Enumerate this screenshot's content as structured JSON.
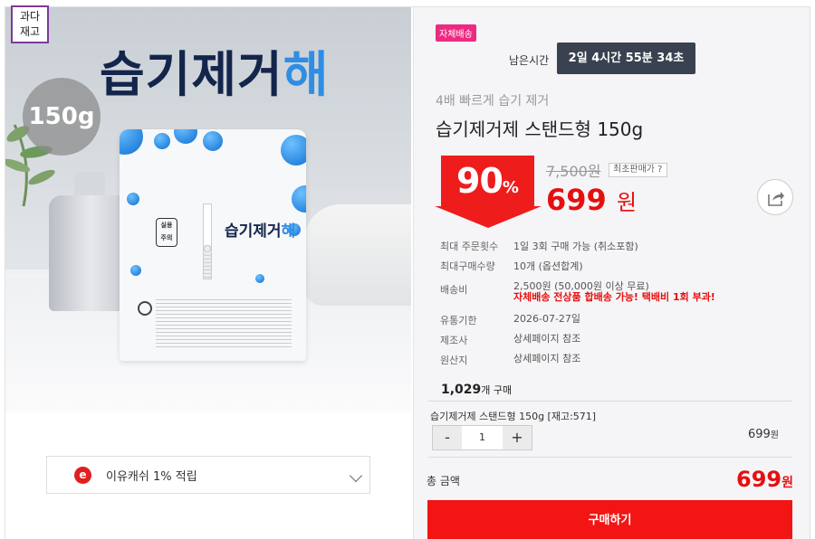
{
  "image": {
    "brand_title_main": "습기제거",
    "brand_title_accent": "해",
    "weight_badge": "150g",
    "overstock_badge_line1": "과다",
    "overstock_badge_line2": "재고",
    "pouch_logo_main": "습기제거",
    "pouch_logo_accent": "해",
    "pouch_caution_line1": "실용",
    "pouch_caution_line2": "주의"
  },
  "points": {
    "icon_letter": "e",
    "label": "이유캐쉬 1% 적립"
  },
  "header": {
    "delivery_badge": "자체배송",
    "remain_label": "남은시간",
    "timer": "2일 4시간 55분 34초"
  },
  "product": {
    "subtitle": "4배 빠르게 습기 제거",
    "title": "습기제거제 스탠드형 150g",
    "discount_number": "90",
    "discount_suffix": "%",
    "original_price": "7,500원",
    "lowest_price_button": "최초판매가 ?",
    "sale_price": "699",
    "sale_unit": "원"
  },
  "info": [
    {
      "label": "최대 주문횟수",
      "value": "1일 3회 구매 가능 (취소포함)"
    },
    {
      "label": "최대구매수량",
      "value": "10개 (옵션합계)"
    },
    {
      "label": "배송비",
      "value": "2,500원 (50,000원 이상 무료)",
      "warn": "자체배송 전상품 합배송 가능! 택배비 1회 부과!"
    },
    {
      "label": "유통기한",
      "value": "2026-07-27일"
    },
    {
      "label": "제조사",
      "value": "상세페이지 참조"
    },
    {
      "label": "원산지",
      "value": "상세페이지 참조"
    }
  ],
  "purchase_count": {
    "number": "1,029",
    "unit": "개 구매"
  },
  "option": {
    "name": "습기제거제 스탠드형 150g [재고:571]",
    "minus": "-",
    "quantity": "1",
    "plus": "+",
    "price": "699",
    "price_unit": "원"
  },
  "total": {
    "label": "총 금액",
    "price": "699",
    "unit": "원"
  },
  "buy_button": "구매하기",
  "colors": {
    "accent_red": "#ef1c1c",
    "badge_pink": "#ec2a82",
    "timer_bg": "#3a4150",
    "brand_blue": "#2f8de4",
    "brand_navy": "#14254b"
  },
  "icons": [
    "share-icon",
    "chevron-down-icon",
    "eyoucash-icon"
  ]
}
